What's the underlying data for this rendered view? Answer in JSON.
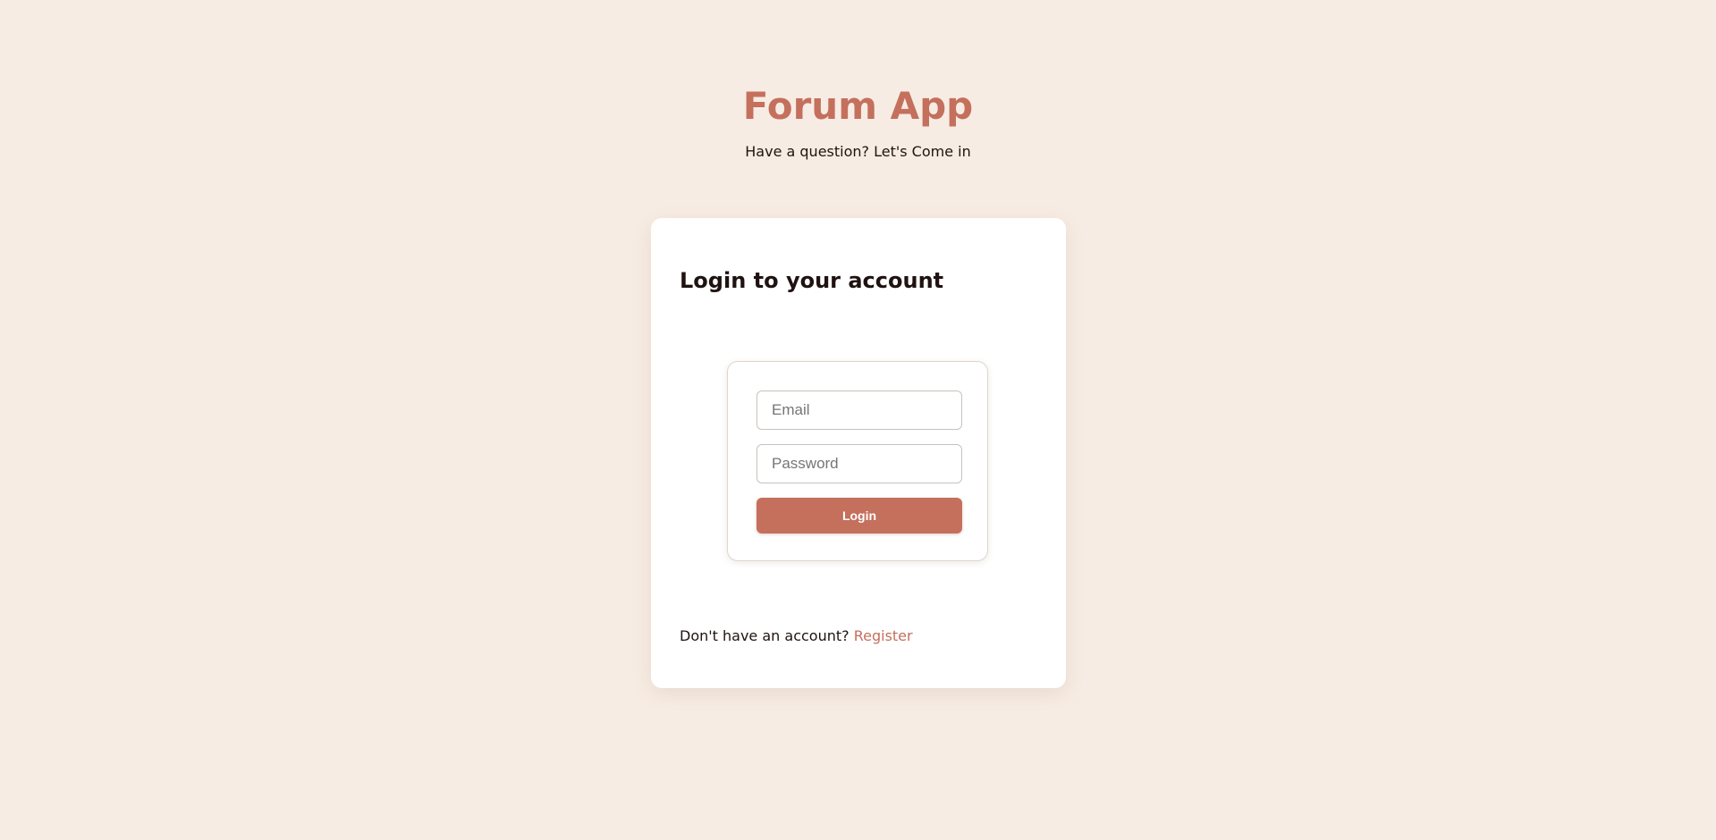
{
  "header": {
    "title": "Forum App",
    "tagline": "Have a question? Let's Come in"
  },
  "login_card": {
    "title": "Login to your account",
    "email_placeholder": "Email",
    "password_placeholder": "Password",
    "login_label": "Login",
    "register_prompt": "Don't have an account?",
    "register_link": "Register"
  },
  "colors": {
    "background": "#f7ece3",
    "accent": "#c4705d",
    "card": "#ffffff",
    "text": "#1f1311"
  }
}
